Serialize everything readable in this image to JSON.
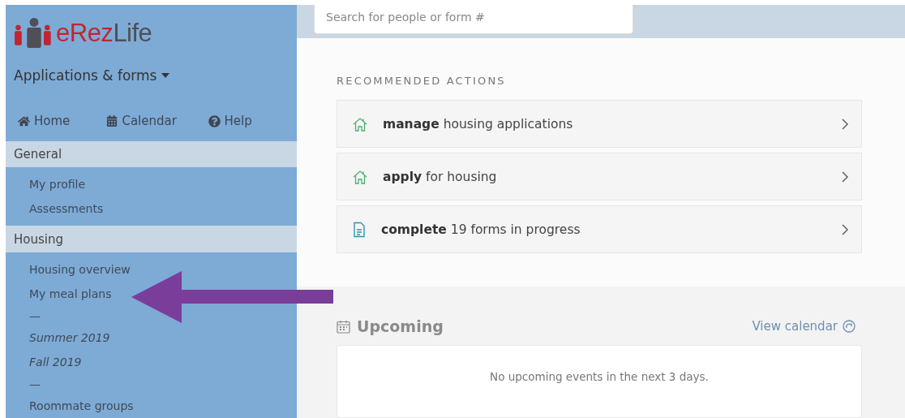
{
  "logo": {
    "primary": "eRez",
    "secondary": "Life"
  },
  "menu_dropdown": {
    "label": "Applications & forms"
  },
  "nav": [
    {
      "label": "Home",
      "kind": "home"
    },
    {
      "label": "Calendar",
      "kind": "calendar"
    },
    {
      "label": "Help",
      "kind": "help"
    }
  ],
  "sidebar": {
    "sections": [
      {
        "title": "General",
        "items": [
          {
            "label": "My profile",
            "kind": "link"
          },
          {
            "label": "Assessments",
            "kind": "link"
          }
        ]
      },
      {
        "title": "Housing",
        "items": [
          {
            "label": "Housing overview",
            "kind": "link"
          },
          {
            "label": "My meal plans",
            "kind": "link"
          },
          {
            "label": "—",
            "kind": "separator"
          },
          {
            "label": "Summer 2019",
            "kind": "term"
          },
          {
            "label": "Fall 2019",
            "kind": "term"
          },
          {
            "label": "—",
            "kind": "separator"
          },
          {
            "label": "Roommate groups",
            "kind": "link"
          }
        ]
      }
    ]
  },
  "search": {
    "placeholder": "Search for people or form #"
  },
  "recommended": {
    "title": "RECOMMENDED ACTIONS",
    "actions": [
      {
        "text": "**manage** housing applications",
        "kind": "housing"
      },
      {
        "text": "**apply** for housing",
        "kind": "housing"
      },
      {
        "text": "**complete** 19 forms in progress",
        "kind": "form"
      }
    ]
  },
  "upcoming": {
    "title": "Upcoming",
    "link": "View calendar",
    "empty_message": "No upcoming events in the next 3 days."
  }
}
